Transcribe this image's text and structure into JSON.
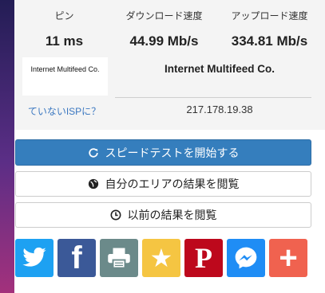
{
  "results": {
    "ping": {
      "label": "ピン",
      "value": "11 ms"
    },
    "download": {
      "label": "ダウンロード速度",
      "value": "44.99 Mb/s"
    },
    "upload": {
      "label": "アップロード速度",
      "value": "334.81 Mb/s"
    }
  },
  "isp": {
    "logo_text": "Internet Multifeed Co.",
    "name": "Internet Multifeed Co.",
    "not_your_isp_link": "ていないISPに？",
    "ip": "217.178.19.38"
  },
  "buttons": {
    "start_test": "スピードテストを開始する",
    "area_results": "自分のエリアの結果を閲覧",
    "past_results": "以前の結果を閲覧"
  },
  "share": [
    {
      "name": "twitter",
      "icon": "twitter-bird-icon",
      "color": "#1da1f2"
    },
    {
      "name": "facebook",
      "icon": "facebook-f-icon",
      "color": "#3b5998"
    },
    {
      "name": "print",
      "icon": "printer-icon",
      "color": "#6b8a8a"
    },
    {
      "name": "favorite",
      "icon": "star-icon",
      "color": "#f5c542"
    },
    {
      "name": "pinterest",
      "icon": "pinterest-p-icon",
      "color": "#bd081c"
    },
    {
      "name": "messenger",
      "icon": "messenger-icon",
      "color": "#1f8df5"
    },
    {
      "name": "more",
      "icon": "plus-icon",
      "color": "#f0624f"
    }
  ]
}
